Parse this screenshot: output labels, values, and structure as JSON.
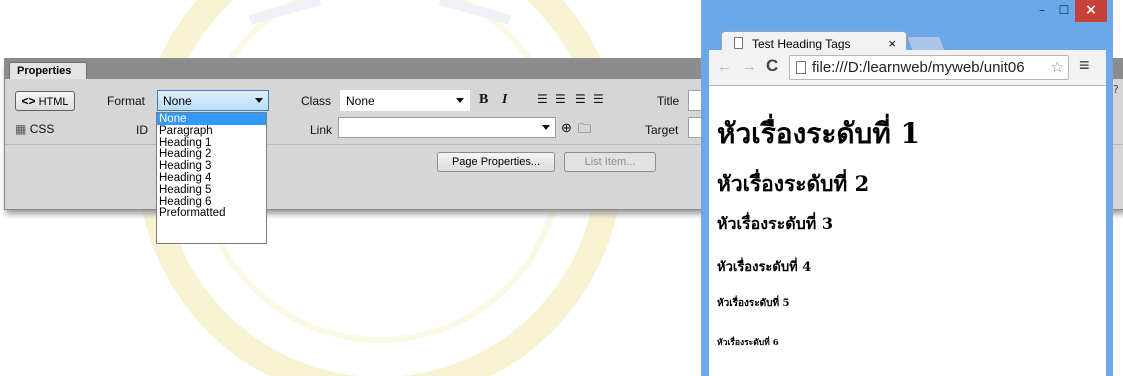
{
  "panel": {
    "tab_label": "Properties",
    "html_button": "HTML",
    "css_button": "CSS",
    "format_label": "Format",
    "format_value": "None",
    "id_label": "ID",
    "class_label": "Class",
    "class_value": "None",
    "bold_label": "B",
    "italic_label": "I",
    "link_label": "Link",
    "title_label": "Title",
    "target_label": "Target",
    "page_properties_button": "Page Properties...",
    "list_item_button": "List Item..."
  },
  "format_options": [
    "None",
    "Paragraph",
    "Heading 1",
    "Heading 2",
    "Heading 3",
    "Heading 4",
    "Heading 5",
    "Heading 6",
    "Preformatted"
  ],
  "browser": {
    "tab_title": "Test Heading Tags",
    "tab_close": "×",
    "url": "file:///D:/learnweb/myweb/unit06",
    "minimize": "–",
    "maximize": "☐",
    "close": "×",
    "menu": "≡"
  },
  "page": {
    "h1": "หัวเรื่องระดับที่ 1",
    "h2": "หัวเรื่องระดับที่ 2",
    "h3": "หัวเรื่องระดับที่ 3",
    "h4": "หัวเรื่องระดับที่ 4",
    "h5": "หัวเรื่องระดับที่ 5",
    "h6": "หัวเรื่องระดับที่ 6"
  },
  "colors": {
    "accent": "#3399ff",
    "window_frame": "#6aa8ea",
    "close_red": "#c7403a",
    "watermark": "#f4f1c8"
  }
}
